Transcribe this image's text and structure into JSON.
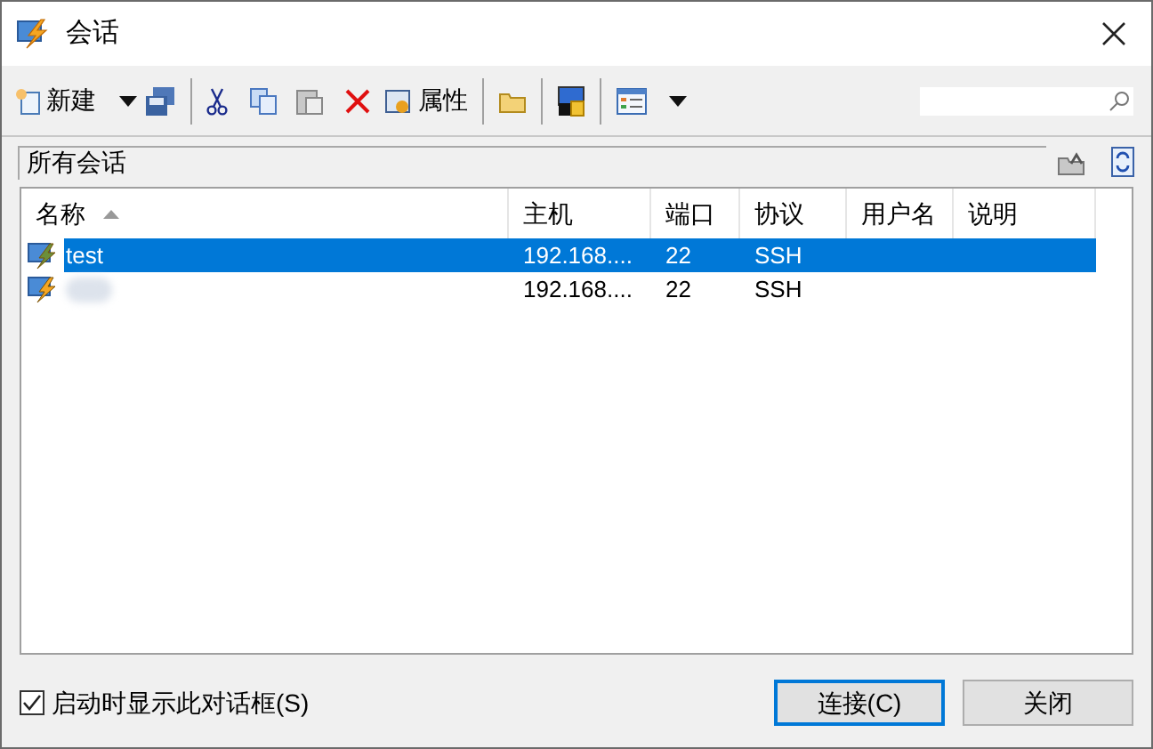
{
  "window": {
    "title": "会话"
  },
  "toolbar": {
    "new_label": "新建",
    "properties_label": "属性"
  },
  "path_bar": {
    "label": "所有会话"
  },
  "table": {
    "columns": [
      {
        "label": "名称",
        "sorted": true
      },
      {
        "label": "主机",
        "sorted": false
      },
      {
        "label": "端口",
        "sorted": false
      },
      {
        "label": "协议",
        "sorted": false
      },
      {
        "label": "用户名",
        "sorted": false
      },
      {
        "label": "说明",
        "sorted": false
      }
    ],
    "rows": [
      {
        "name": "test",
        "host": "192.168....",
        "port": "22",
        "protocol": "SSH",
        "selected": true
      },
      {
        "host": "192.168....",
        "port": "22",
        "protocol": "SSH",
        "selected": false
      }
    ]
  },
  "startup_checkbox": {
    "label": "启动时显示此对话框(S)",
    "checked": true
  },
  "buttons": [
    {
      "label": "连接(C)",
      "kind": "default"
    },
    {
      "label": "关闭",
      "kind": "normal"
    }
  ]
}
